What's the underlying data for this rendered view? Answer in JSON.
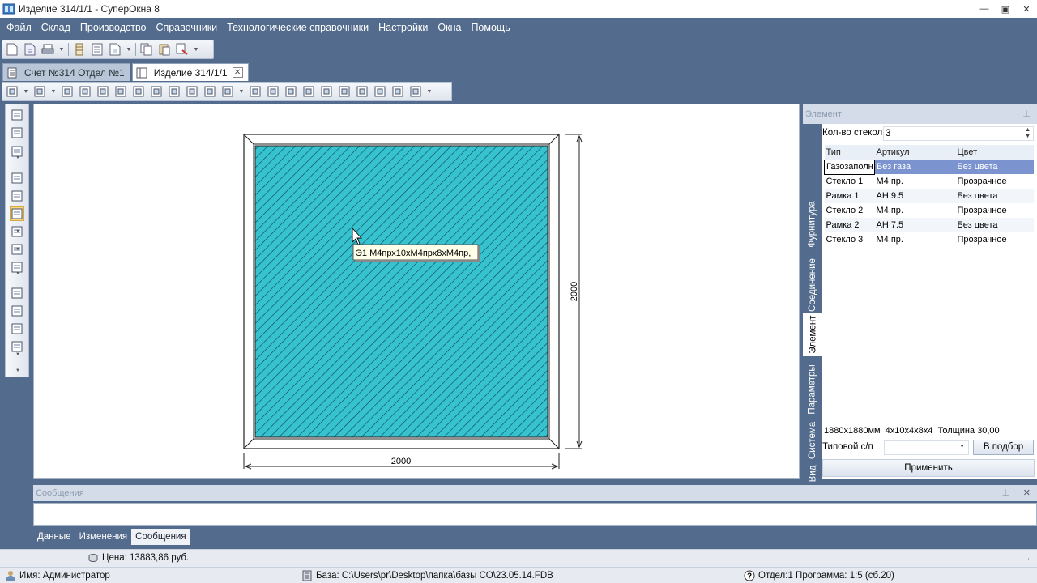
{
  "window": {
    "title": "Изделие 314/1/1 - СуперОкна 8",
    "buttons": {
      "minimize": "—",
      "maximize": "▣",
      "close": "✕"
    }
  },
  "menu": [
    "Файл",
    "Склад",
    "Производство",
    "Справочники",
    "Технологические справочники",
    "Настройки",
    "Окна",
    "Помощь"
  ],
  "doc_tabs": [
    {
      "label": "Счет №314 Отдел №1",
      "active": false
    },
    {
      "label": "Изделие 314/1/1",
      "active": true,
      "close": "✕"
    }
  ],
  "canvas": {
    "tooltip": "Э1 М4прх10хМ4прх8хМ4пр,",
    "dim_width": "2000",
    "dim_height": "2000",
    "glass_color": "#36c3cf"
  },
  "element_panel": {
    "header": "Элемент",
    "pin": "⊥",
    "glass_count_label": "Кол-во стекол",
    "glass_count_value": "3",
    "vertical_tabs": [
      "Фурнитура",
      "Соединение",
      "Элемент",
      "Параметры",
      "Система",
      "Вид"
    ],
    "active_tab": "Элемент",
    "table": {
      "columns": [
        "Тип",
        "Артикул",
        "Цвет"
      ],
      "rows": [
        [
          "Газозаполн",
          "Без газа",
          "Без цвета"
        ],
        [
          "Стекло 1",
          "М4 пр.",
          "Прозрачное"
        ],
        [
          "Рамка 1",
          "АН 9.5",
          "Без цвета"
        ],
        [
          "Стекло 2",
          "М4 пр.",
          "Прозрачное"
        ],
        [
          "Рамка 2",
          "АН 7.5",
          "Без цвета"
        ],
        [
          "Стекло 3",
          "М4 пр.",
          "Прозрачное"
        ]
      ]
    },
    "info_line": "1880x1880мм  4x10x4x8x4  Толщина 30,00",
    "typical_label": "Типовой с/п",
    "typical_value": "",
    "select_button": "В подбор",
    "apply_button": "Применить"
  },
  "messages_panel": {
    "header": "Сообщения",
    "pin": "⊥",
    "close": "✕",
    "tabs": [
      "Данные",
      "Изменения",
      "Сообщения"
    ],
    "active_tab": "Сообщения"
  },
  "status": {
    "price": "Цена: 13883,86 руб.",
    "user": "Имя: Администратор",
    "database": "База: C:\\Users\\pr\\Desktop\\папка\\базы СО\\23.05.14.FDB",
    "program": "Отдел:1 Программа: 1:5 (сб.20)"
  },
  "colors": {
    "accent": "#536b8c",
    "selection": "#7b93cf",
    "glass": "#36c3cf"
  }
}
